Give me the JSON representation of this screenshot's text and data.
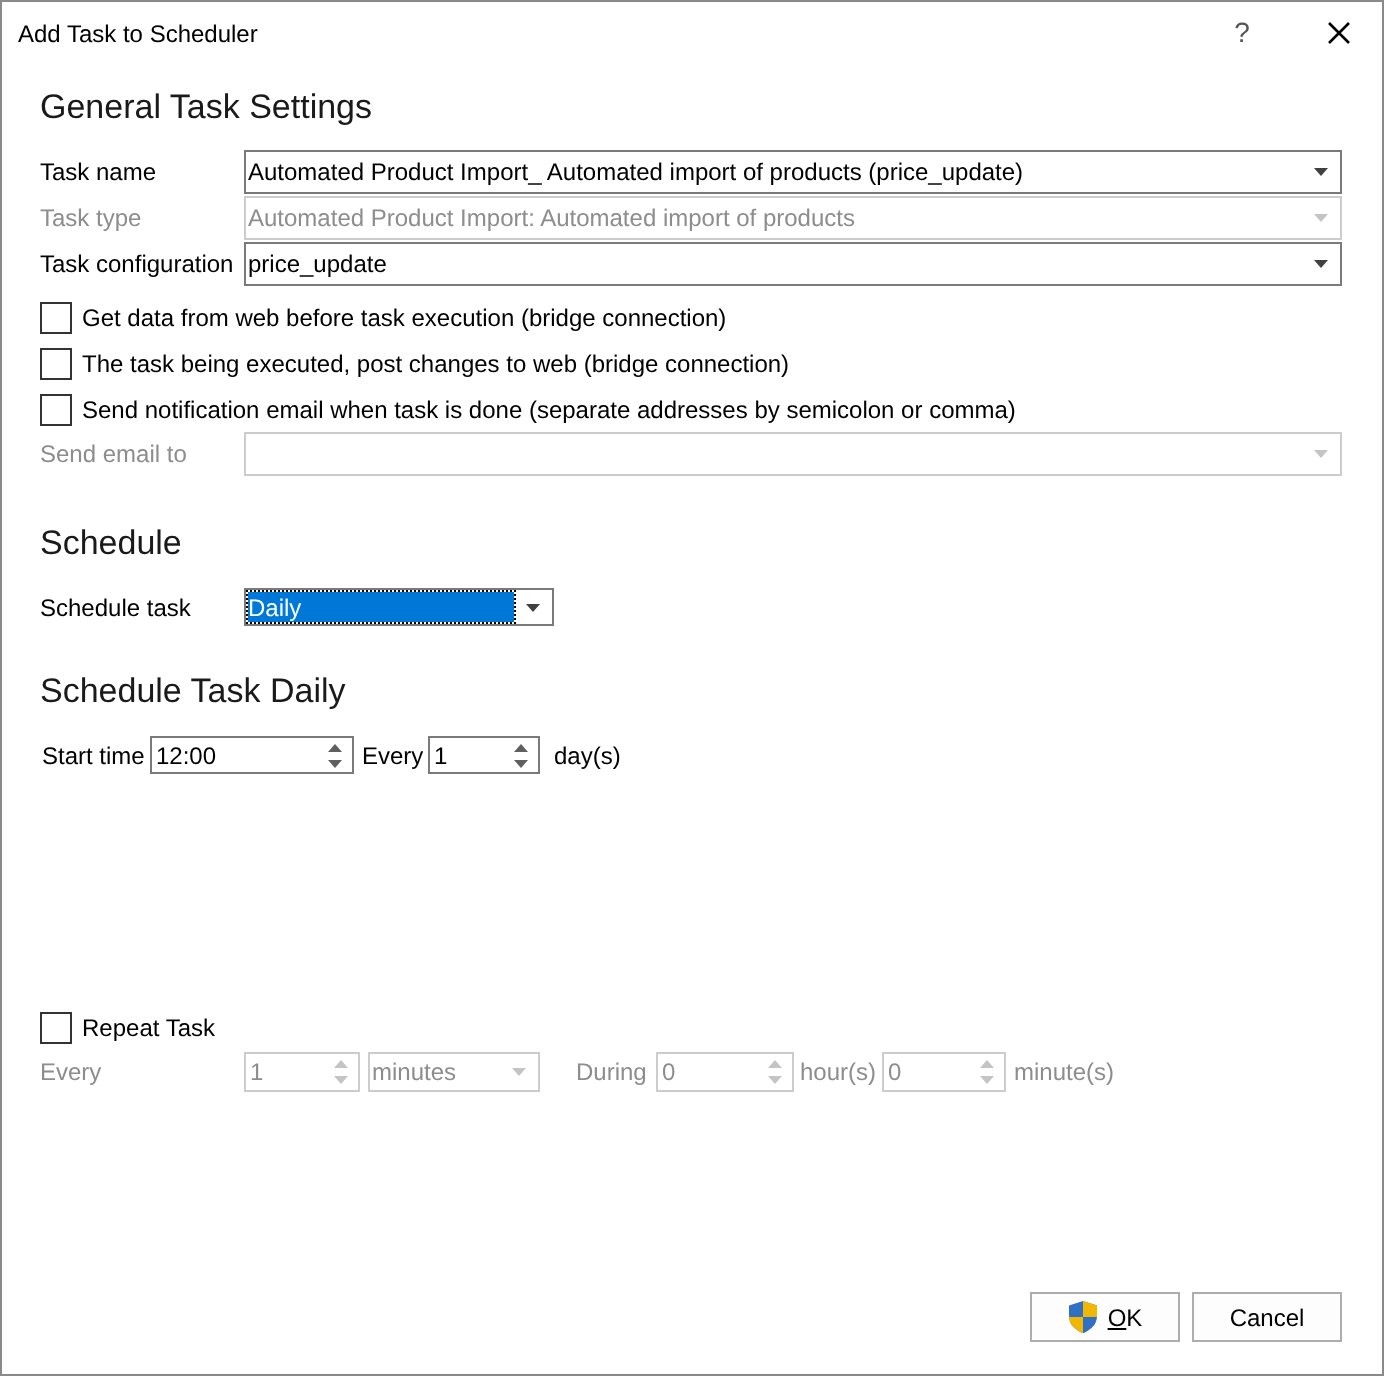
{
  "window": {
    "title": "Add Task to Scheduler",
    "help": "?"
  },
  "general": {
    "heading": "General Task Settings",
    "fields": [
      {
        "label": "Task name",
        "value": "Automated Product Import_ Automated import of products (price_update)",
        "disabled": false
      },
      {
        "label": "Task type",
        "value": "Automated Product Import: Automated import of products",
        "disabled": true
      },
      {
        "label": "Task configuration",
        "value": "price_update",
        "disabled": false
      }
    ],
    "options": [
      {
        "label": "Get data from web before task execution (bridge connection)",
        "checked": false
      },
      {
        "label": "The task being executed, post changes to web (bridge connection)",
        "checked": false
      },
      {
        "label": "Send notification email when task is done (separate addresses by semicolon or comma)",
        "checked": false
      }
    ],
    "send_email": {
      "label": "Send email to",
      "disabled": true
    }
  },
  "schedule": {
    "heading": "Schedule",
    "label": "Schedule task",
    "value": "Daily",
    "focused": true
  },
  "daily": {
    "heading": "Schedule Task Daily",
    "start_label": "Start time",
    "start_value": "12:00",
    "every_label": "Every",
    "every_value": "1",
    "unit": "day(s)"
  },
  "repeat": {
    "label": "Repeat Task",
    "checked": false,
    "every_label": "Every",
    "every_value": "1",
    "period": "minutes",
    "during_label": "During",
    "hours_value": "0",
    "hours_unit": "hour(s)",
    "minutes_value": "0",
    "minutes_unit": "minute(s)"
  },
  "buttons": [
    {
      "label": "OK",
      "kind": "shield",
      "mnemonic": true
    },
    {
      "label": "Cancel",
      "kind": "plain",
      "mnemonic": false
    }
  ]
}
